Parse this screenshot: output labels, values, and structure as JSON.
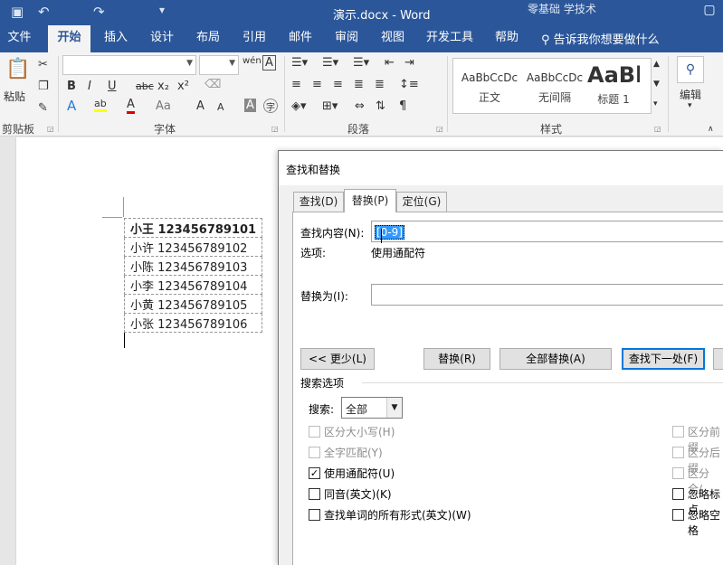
{
  "titlebar": {
    "doc_title": "演示.docx  -  Word",
    "right_text": "零基础 学技术",
    "save_icon": "▣",
    "undo_icon": "↶",
    "redo_icon": "↷",
    "customize_icon": "▾"
  },
  "tabs": [
    "文件",
    "开始",
    "插入",
    "设计",
    "布局",
    "引用",
    "邮件",
    "审阅",
    "视图",
    "开发工具",
    "帮助"
  ],
  "tell_me": "告诉我你想要做什么",
  "ribbon": {
    "clipboard": {
      "paste": "粘贴",
      "label": "剪贴板"
    },
    "font": {
      "label": "字体",
      "bold": "B",
      "italic": "I",
      "underline": "U",
      "strike": "abc",
      "sub": "x₂",
      "sup": "x²",
      "grow": "A",
      "shrink": "A",
      "case": "Aa",
      "clear": "A"
    },
    "paragraph": {
      "label": "段落"
    },
    "styles": {
      "label": "样式",
      "items": [
        {
          "sample": "AaBbCcDc",
          "name": "正文"
        },
        {
          "sample": "AaBbCcDc",
          "name": "无间隔"
        },
        {
          "sample": "AaBl",
          "name": "标题 1"
        }
      ]
    },
    "editing": {
      "label": "编辑"
    }
  },
  "document": {
    "rows": [
      {
        "name": "小王",
        "num": "123456789101"
      },
      {
        "name": "小许",
        "num": "123456789102"
      },
      {
        "name": "小陈",
        "num": "123456789103"
      },
      {
        "name": "小李",
        "num": "123456789104"
      },
      {
        "name": "小黄",
        "num": "123456789105"
      },
      {
        "name": "小张",
        "num": "123456789106"
      }
    ]
  },
  "dialog": {
    "title": "查找和替换",
    "tabs": {
      "find": "查找(D)",
      "replace": "替换(P)",
      "goto": "定位(G)"
    },
    "find_label": "查找内容(N):",
    "find_value": "[0-9]",
    "options_label": "选项:",
    "options_value": "使用通配符",
    "replace_label": "替换为(I):",
    "replace_value": "",
    "buttons": {
      "less": "<< 更少(L)",
      "replace": "替换(R)",
      "replace_all": "全部替换(A)",
      "find_next": "查找下一处(F)"
    },
    "search_options_title": "搜索选项",
    "search_label": "搜索:",
    "search_value": "全部",
    "left_checks": [
      {
        "label": "区分大小写(H)",
        "checked": false,
        "disabled": true
      },
      {
        "label": "全字匹配(Y)",
        "checked": false,
        "disabled": true
      },
      {
        "label": "使用通配符(U)",
        "checked": true,
        "disabled": false
      },
      {
        "label": "同音(英文)(K)",
        "checked": false,
        "disabled": false
      },
      {
        "label": "查找单词的所有形式(英文)(W)",
        "checked": false,
        "disabled": false
      }
    ],
    "right_checks": [
      {
        "label": "区分前缀",
        "checked": false,
        "disabled": true
      },
      {
        "label": "区分后缀",
        "checked": false,
        "disabled": true
      },
      {
        "label": "区分全/",
        "checked": false,
        "disabled": true
      },
      {
        "label": "忽略标点",
        "checked": false,
        "disabled": false
      },
      {
        "label": "忽略空格",
        "checked": false,
        "disabled": false
      }
    ]
  }
}
